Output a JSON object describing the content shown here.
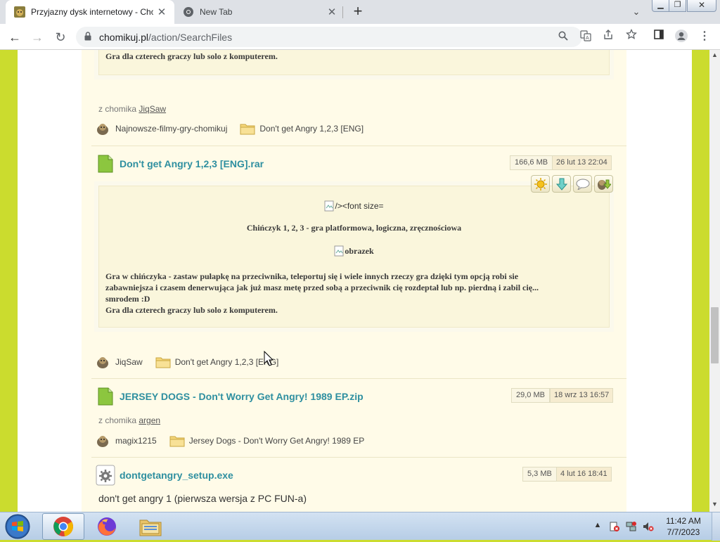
{
  "browser": {
    "tabs": [
      {
        "title": "Przyjazny dysk internetowy - Chomikuj.pl"
      },
      {
        "title": "New Tab"
      }
    ],
    "new_tab_label": "+",
    "url_host": "chomikuj.pl",
    "url_path": "/action/SearchFiles"
  },
  "results": [
    {
      "partial_desc_line": "Gra dla czterech graczy lub solo z komputerem.",
      "from_label": "z chomika",
      "from_user": "JiqSaw",
      "owner": "Najnowsze-filmy-gry-chomikuj",
      "folder": "Don't get Angry 1,2,3 [ENG]"
    },
    {
      "title": "Don't get Angry 1,2,3 [ENG].rar",
      "size": "166,6 MB",
      "date": "26 lut 13 22:04",
      "desc_broken_img_1": "/><font size=",
      "desc_heading": "Chińczyk 1, 2, 3 - gra platformowa, logiczna, zręcznościowa",
      "desc_broken_img_2": "obrazek",
      "desc_line_1": "Gra w chińczyka - zastaw pułapkę na przeciwnika, teleportuj się i wiele innych rzeczy gra dzięki tym opcją robi sie",
      "desc_line_2": "zabawniejsza i czasem denerwująca jak już masz metę przed sobą a przeciwnik cię rozdeptał lub np. pierdną i zabil cię...",
      "desc_line_3": "smrodem :D",
      "desc_line_4": "Gra dla czterech graczy lub solo z komputerem.",
      "owner": "JiqSaw",
      "folder": "Don't get Angry 1,2,3 [ENG]"
    },
    {
      "title": "JERSEY DOGS - Don't Worry Get Angry! 1989 EP.zip",
      "size": "29,0 MB",
      "date": "18 wrz 13 16:57",
      "from_label": "z chomika",
      "from_user": "argen",
      "owner": "magix1215",
      "folder": "Jersey Dogs - Don't Worry Get Angry! 1989 EP"
    },
    {
      "title": "dontgetangry_setup.exe",
      "size": "5,3 MB",
      "date": "4 lut 16 18:41",
      "desc": "don't get angry 1 (pierwsza wersja z PC FUN-a)"
    }
  ],
  "taskbar": {
    "time": "11:42 AM",
    "date": "7/7/2023"
  },
  "colors": {
    "accent_title": "#2e8fa0",
    "page_background": "#cbdc2e",
    "content_background": "#fffbe8"
  },
  "icons": [
    "chomikuj-favicon",
    "chrome-favicon",
    "lock-icon",
    "search-icon",
    "translate-icon",
    "share-icon",
    "star-icon",
    "sidepanel-icon",
    "profile-icon",
    "menu-icon",
    "file-archive-icon",
    "file-exe-icon",
    "folder-icon",
    "avatar-icon",
    "star-action-icon",
    "download-action-icon",
    "comment-action-icon",
    "save-action-icon",
    "windows-start-icon",
    "chrome-app-icon",
    "firefox-app-icon",
    "explorer-app-icon"
  ]
}
